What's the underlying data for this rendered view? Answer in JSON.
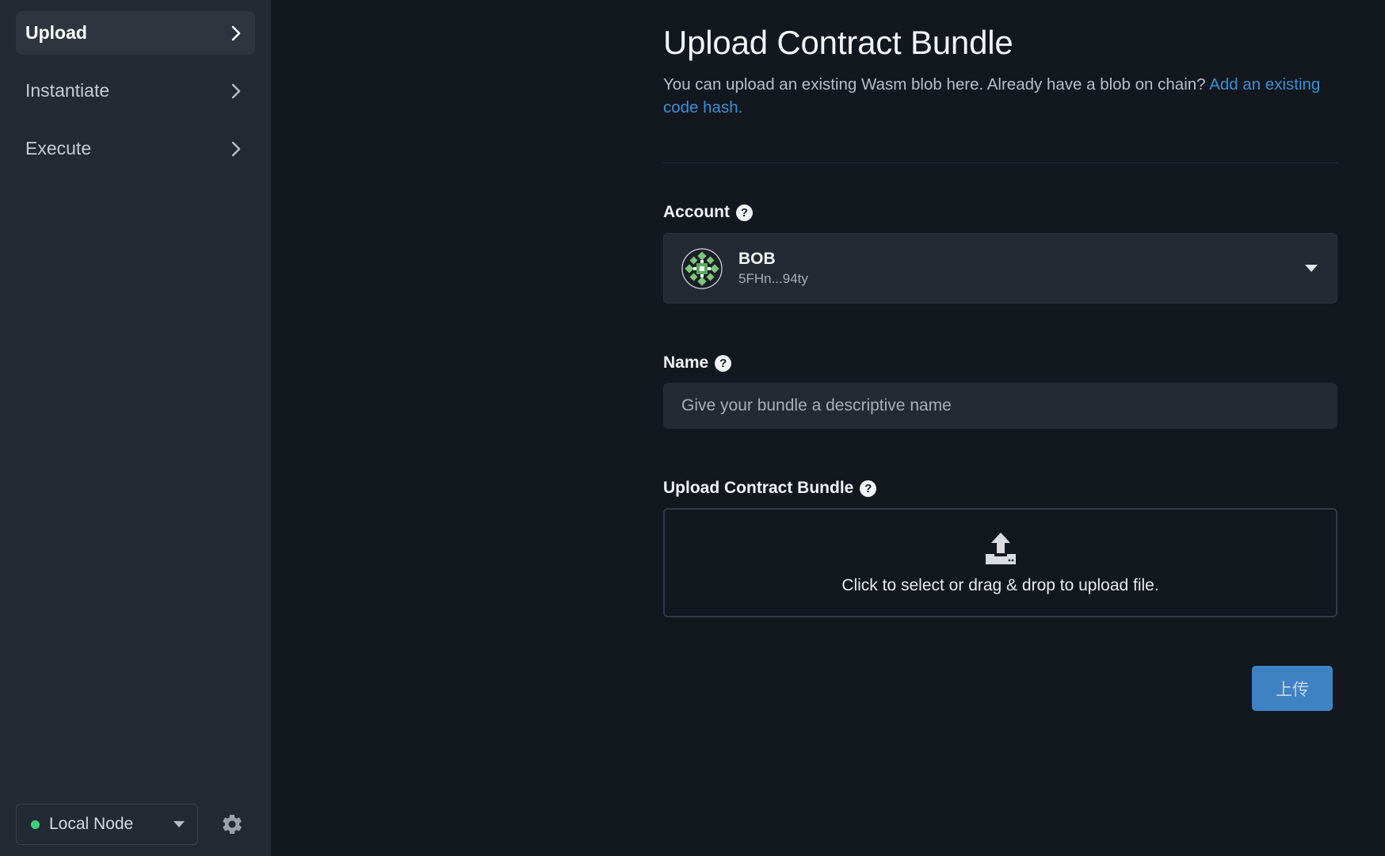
{
  "sidebar": {
    "items": [
      {
        "label": "Upload",
        "active": true
      },
      {
        "label": "Instantiate",
        "active": false
      },
      {
        "label": "Execute",
        "active": false
      }
    ],
    "node_select": {
      "label": "Local Node",
      "status_color": "#3ecf7a"
    },
    "settings_icon": "gear-icon"
  },
  "main": {
    "title": "Upload Contract Bundle",
    "description": "You can upload an existing Wasm blob here. Already have a blob on chain?",
    "description_link": "Add an existing code hash.",
    "account": {
      "label": "Account",
      "name": "BOB",
      "address": "5FHn...94ty"
    },
    "name_field": {
      "label": "Name",
      "placeholder": "Give your bundle a descriptive name",
      "value": ""
    },
    "bundle": {
      "label": "Upload Contract Bundle",
      "drop_text": "Click to select or drag & drop to upload file."
    },
    "submit_label": "上传",
    "help_glyph": "?"
  },
  "colors": {
    "accent": "#3f82c4",
    "link": "#3d8fd6",
    "background": "#13171e",
    "sidebar": "#232a33"
  }
}
